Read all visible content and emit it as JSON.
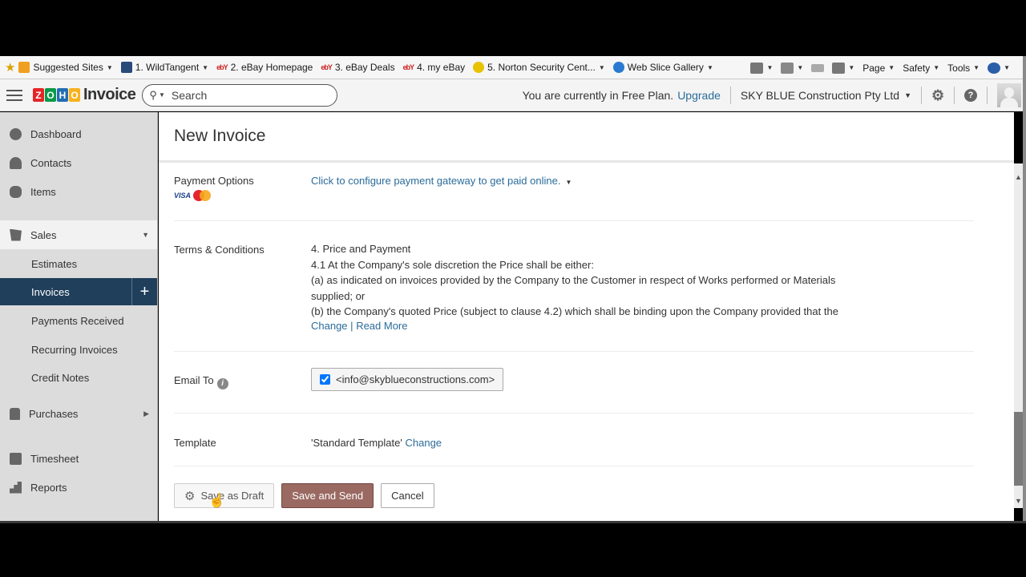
{
  "browser": {
    "favorites": [
      {
        "label": "Suggested Sites",
        "icon": "suggested-sites-icon",
        "dropdown": true,
        "color": "#f0a020"
      },
      {
        "label": "1. WildTangent",
        "icon": "wildtangent-icon",
        "dropdown": true,
        "color": "#2a4a7a"
      },
      {
        "label": "2. eBay Homepage",
        "icon": "ebay-icon",
        "dropdown": false
      },
      {
        "label": "3. eBay Deals",
        "icon": "ebay-icon",
        "dropdown": false
      },
      {
        "label": "4. my eBay",
        "icon": "ebay-icon",
        "dropdown": false
      },
      {
        "label": "5. Norton Security Cent...",
        "icon": "norton-icon",
        "dropdown": true,
        "color": "#e8c200"
      },
      {
        "label": "Web Slice Gallery",
        "icon": "ie-icon",
        "dropdown": true,
        "color": "#2a7ad0"
      }
    ],
    "commands": {
      "page": "Page",
      "safety": "Safety",
      "tools": "Tools"
    }
  },
  "header": {
    "app_name": "Invoice",
    "logo_letters": [
      "Z",
      "O",
      "H",
      "O"
    ],
    "logo_colors": [
      "#e42527",
      "#089949",
      "#226db4",
      "#f9b21d"
    ],
    "search_placeholder": "Search",
    "plan_text": "You are currently in Free Plan.",
    "upgrade_label": "Upgrade",
    "organization": "SKY BLUE Construction Pty Ltd"
  },
  "sidebar": {
    "items": [
      {
        "label": "Dashboard",
        "icon": "dashboard-icon"
      },
      {
        "label": "Contacts",
        "icon": "contacts-icon"
      },
      {
        "label": "Items",
        "icon": "items-icon"
      },
      {
        "label": "Sales",
        "icon": "sales-icon",
        "expanded": true
      },
      {
        "label": "Estimates"
      },
      {
        "label": "Invoices",
        "active": true
      },
      {
        "label": "Payments Received"
      },
      {
        "label": "Recurring Invoices"
      },
      {
        "label": "Credit Notes"
      },
      {
        "label": "Purchases",
        "icon": "purchases-icon"
      },
      {
        "label": "Timesheet",
        "icon": "timesheet-icon"
      },
      {
        "label": "Reports",
        "icon": "reports-icon"
      }
    ],
    "active_color": "#1f3f5b"
  },
  "main": {
    "title": "New Invoice",
    "payment_options": {
      "label": "Payment Options",
      "value": "Click to configure payment gateway to get paid online.",
      "card_visa": "VISA"
    },
    "terms": {
      "label": "Terms & Conditions",
      "lines": [
        "4. Price and Payment",
        "4.1 At the Company's sole discretion the Price shall be either:",
        "(a) as indicated on invoices provided by the Company to the Customer in respect of Works performed or Materials",
        "supplied; or",
        "(b) the Company's quoted Price (subject to clause 4.2) which shall be binding upon the Company provided that the"
      ],
      "change_label": "Change",
      "separator": "|",
      "read_more_label": "Read More"
    },
    "email_to": {
      "label": "Email To",
      "recipient": "<info@skyblueconstructions.com>",
      "checked": true
    },
    "template": {
      "label": "Template",
      "value": "'Standard Template'",
      "change_label": "Change"
    },
    "actions": {
      "save_draft": "Save as Draft",
      "save_send": "Save and Send",
      "cancel": "Cancel"
    }
  }
}
